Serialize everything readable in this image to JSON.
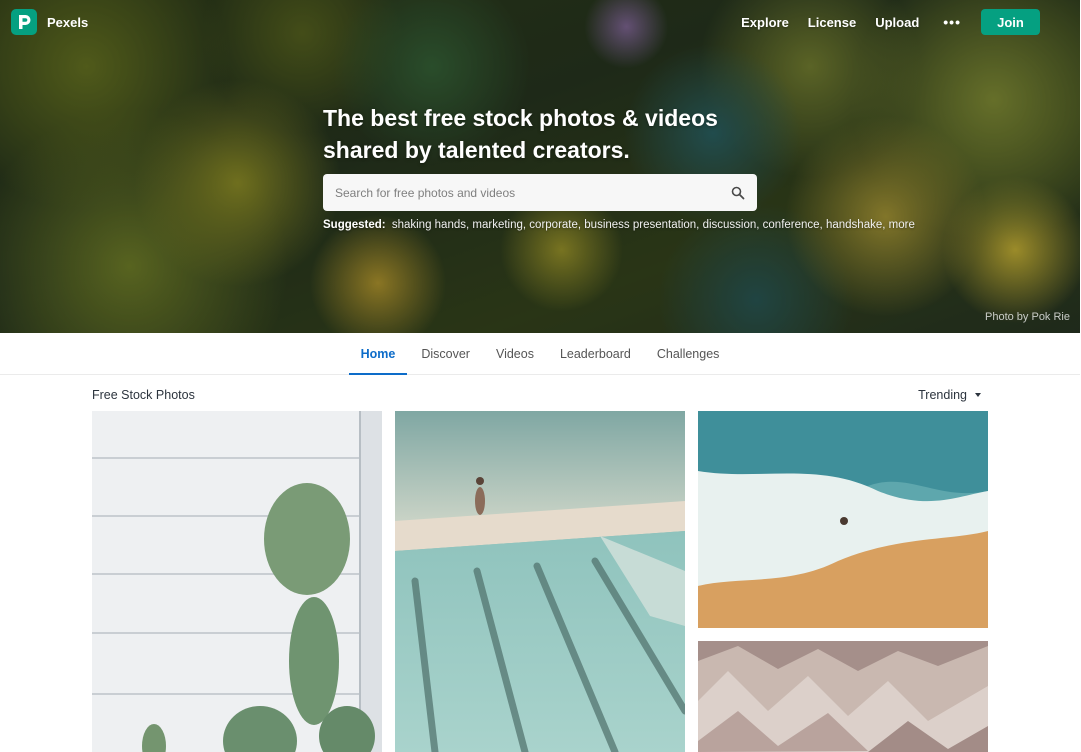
{
  "brand": {
    "name": "Pexels",
    "accent": "#05a081"
  },
  "nav": {
    "links": [
      "Explore",
      "License",
      "Upload"
    ],
    "more": "•••",
    "join": "Join"
  },
  "hero": {
    "headline_line1": "The best free stock photos & videos",
    "headline_line2": "shared by talented creators.",
    "search_placeholder": "Search for free photos and videos",
    "suggested_label": "Suggested:",
    "suggested_tags": [
      "shaking hands,",
      "marketing,",
      "corporate,",
      "business presentation,",
      "discussion,",
      "conference,",
      "handshake,",
      "more"
    ],
    "credit": "Photo by Pok Rie"
  },
  "tabs": [
    {
      "label": "Home",
      "active": true
    },
    {
      "label": "Discover",
      "active": false
    },
    {
      "label": "Videos",
      "active": false
    },
    {
      "label": "Leaderboard",
      "active": false
    },
    {
      "label": "Challenges",
      "active": false
    }
  ],
  "section": {
    "title": "Free Stock Photos",
    "sort": "Trending"
  },
  "photos": [
    {
      "name": "cactus-against-white-wall"
    },
    {
      "name": "swimmer-by-pool"
    },
    {
      "name": "aerial-beach-waves"
    },
    {
      "name": "pink-mountain-ridges"
    }
  ]
}
